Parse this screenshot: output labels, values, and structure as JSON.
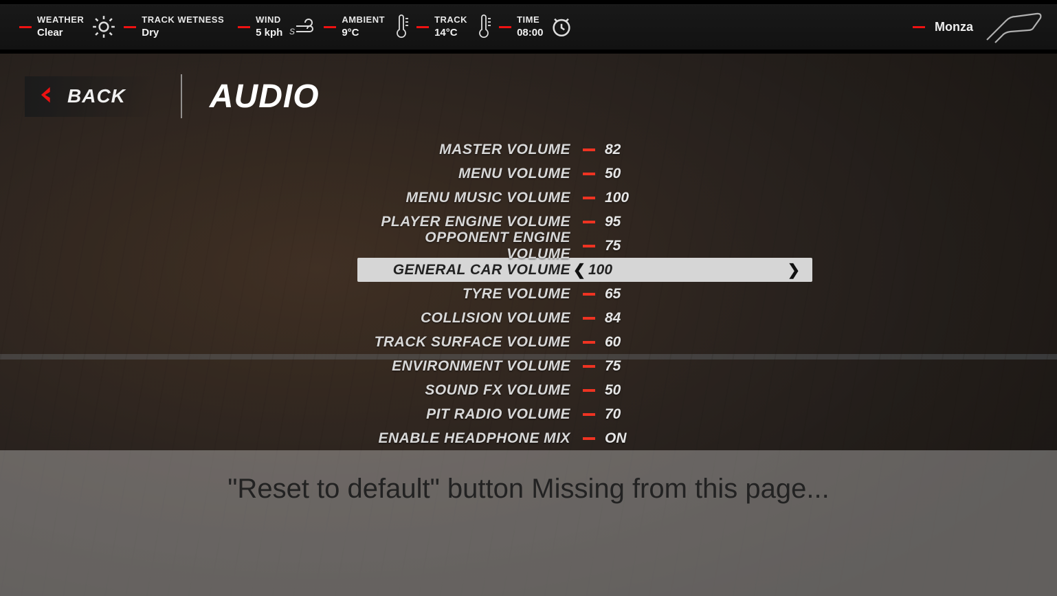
{
  "topbar": {
    "weather": {
      "label": "WEATHER",
      "value": "Clear"
    },
    "wetness": {
      "label": "TRACK WETNESS",
      "value": "Dry"
    },
    "wind": {
      "label": "WIND",
      "value": "5 kph"
    },
    "ambient": {
      "label": "AMBIENT",
      "value": "9°C"
    },
    "track_temp": {
      "label": "TRACK",
      "value": "14°C"
    },
    "time": {
      "label": "TIME",
      "value": "08:00"
    },
    "track_name": "Monza"
  },
  "header": {
    "back": "BACK",
    "title": "AUDIO"
  },
  "settings": {
    "selected_index": 5,
    "items": [
      {
        "label": "MASTER VOLUME",
        "value": "82"
      },
      {
        "label": "MENU VOLUME",
        "value": "50"
      },
      {
        "label": "MENU MUSIC VOLUME",
        "value": "100"
      },
      {
        "label": "PLAYER ENGINE VOLUME",
        "value": "95"
      },
      {
        "label": "OPPONENT ENGINE VOLUME",
        "value": "75"
      },
      {
        "label": "GENERAL CAR VOLUME",
        "value": "100"
      },
      {
        "label": "TYRE VOLUME",
        "value": "65"
      },
      {
        "label": "COLLISION VOLUME",
        "value": "84"
      },
      {
        "label": "TRACK SURFACE VOLUME",
        "value": "60"
      },
      {
        "label": "ENVIRONMENT VOLUME",
        "value": "75"
      },
      {
        "label": "SOUND FX VOLUME",
        "value": "50"
      },
      {
        "label": "PIT RADIO VOLUME",
        "value": "70"
      },
      {
        "label": "ENABLE HEADPHONE MIX",
        "value": "ON"
      }
    ]
  },
  "caption": "\"Reset to default\" button Missing from this page...",
  "colors": {
    "accent": "#e11"
  }
}
